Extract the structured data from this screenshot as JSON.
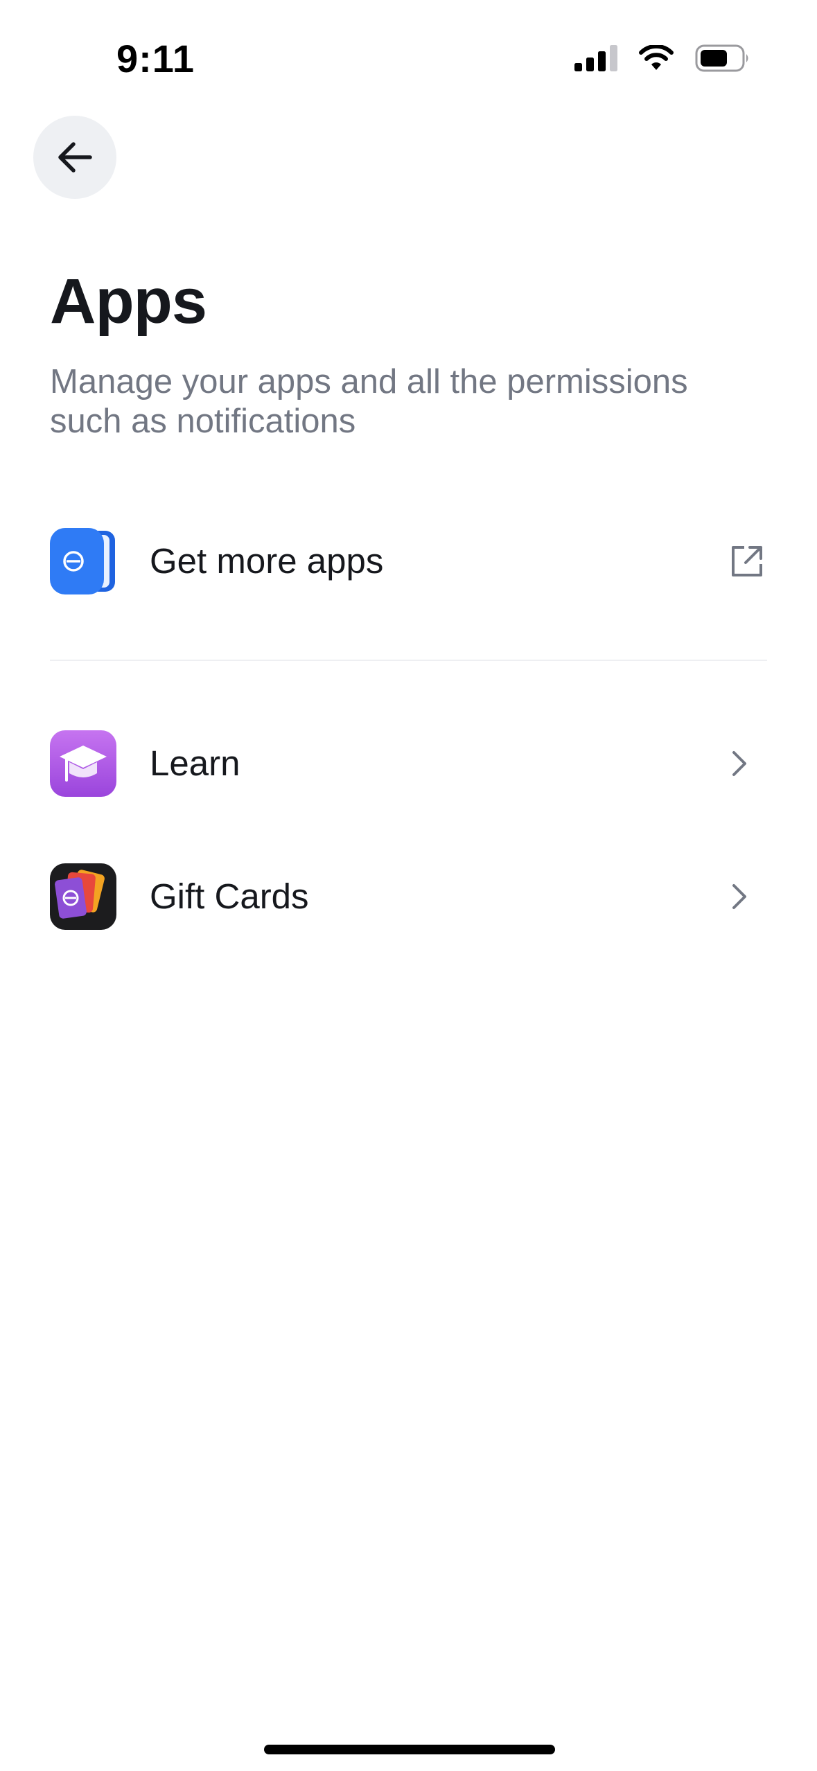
{
  "status_bar": {
    "time": "9:11",
    "icons": [
      "signal-icon",
      "wifi-icon",
      "battery-icon"
    ]
  },
  "header": {
    "back_icon": "arrow-left-icon"
  },
  "page": {
    "title": "Apps",
    "subtitle": "Manage your apps and all the permissions such as notifications"
  },
  "external_link": {
    "label": "Get more apps",
    "icon": "wallet-app-icon",
    "trailing_icon": "external-link-icon"
  },
  "apps": [
    {
      "label": "Learn",
      "icon": "graduation-cap-icon",
      "trailing_icon": "chevron-right-icon"
    },
    {
      "label": "Gift Cards",
      "icon": "gift-cards-icon",
      "trailing_icon": "chevron-right-icon"
    }
  ],
  "colors": {
    "title": "#16181d",
    "subtitle": "#727783",
    "back_button_bg": "#eef0f3",
    "divider": "#eeeff2",
    "wallet_blue": "#2f7bf5",
    "learn_purple": "#b25ee8",
    "gift_dark": "#1c1c1e",
    "chevron": "#727783"
  }
}
